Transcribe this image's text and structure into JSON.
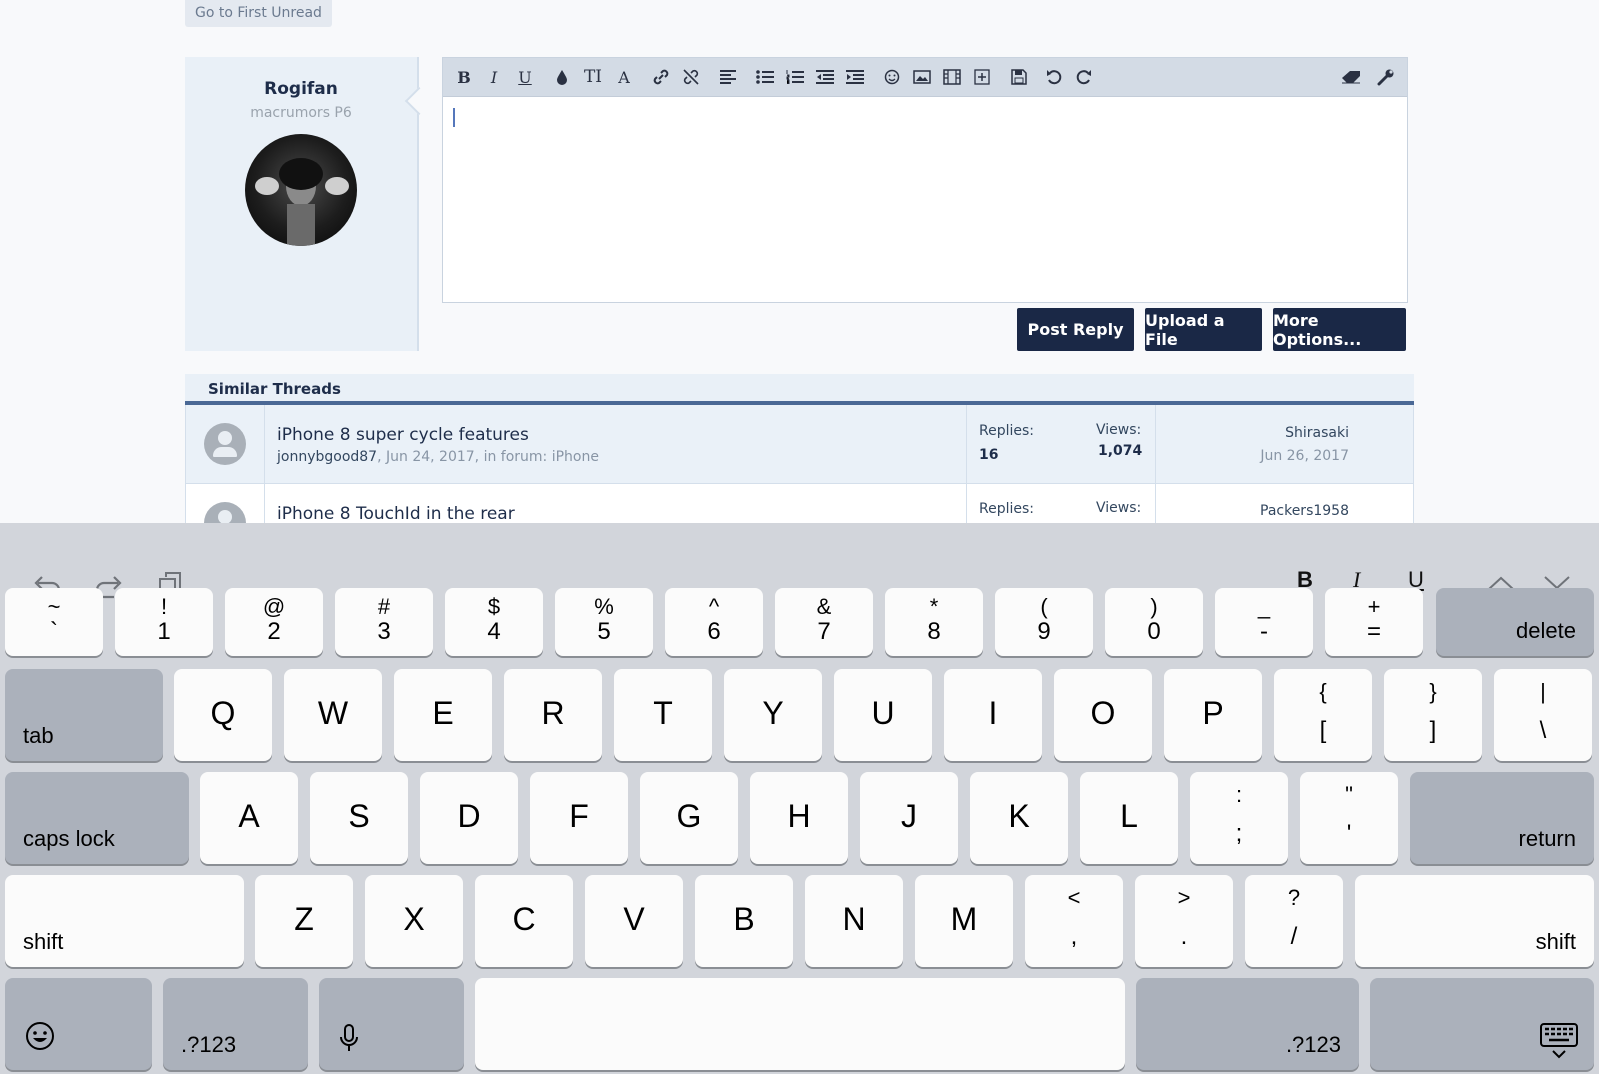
{
  "forum": {
    "first_unread": "Go to First Unread",
    "user": {
      "name": "Rogifan",
      "title": "macrumors P6"
    },
    "toolbar": {
      "icons": [
        "bold-icon",
        "italic-icon",
        "underline-icon",
        "text-color-icon",
        "font-size-icon",
        "font-family-icon",
        "link-icon",
        "unlink-icon",
        "align-icon",
        "bullet-list-icon",
        "numbered-list-icon",
        "outdent-icon",
        "indent-icon",
        "smilies-icon",
        "image-icon",
        "media-icon",
        "insert-icon",
        "save-draft-icon",
        "undo-icon",
        "redo-icon",
        "remove-format-icon",
        "settings-icon"
      ]
    },
    "buttons": {
      "post_reply": "Post Reply",
      "upload": "Upload a File",
      "more": "More Options..."
    },
    "similar": {
      "heading": "Similar Threads",
      "threads": [
        {
          "title": "iPhone 8 super cycle features",
          "starter": "jonnybgood87",
          "meta": ", Jun 24, 2017, in forum: iPhone",
          "replies_label": "Replies:",
          "replies": "16",
          "views_label": "Views:",
          "views": "1,074",
          "last_user": "Shirasaki",
          "last_date": "Jun 26, 2017"
        },
        {
          "title": "iPhone 8 TouchId in the rear",
          "replies_label": "Replies:",
          "views_label": "Views:",
          "last_user": "Packers1958"
        }
      ]
    }
  },
  "keyboard": {
    "suggestion_bar": {
      "bold": "B",
      "italic": "I",
      "underline": "U"
    },
    "number_row": [
      {
        "top": "~",
        "bot": "`"
      },
      {
        "top": "!",
        "bot": "1"
      },
      {
        "top": "@",
        "bot": "2"
      },
      {
        "top": "#",
        "bot": "3"
      },
      {
        "top": "$",
        "bot": "4"
      },
      {
        "top": "%",
        "bot": "5"
      },
      {
        "top": "^",
        "bot": "6"
      },
      {
        "top": "&",
        "bot": "7"
      },
      {
        "top": "*",
        "bot": "8"
      },
      {
        "top": "(",
        "bot": "9"
      },
      {
        "top": ")",
        "bot": "0"
      },
      {
        "top": "_",
        "bot": "-"
      },
      {
        "top": "+",
        "bot": "="
      }
    ],
    "delete": "delete",
    "tab": "tab",
    "row_q": [
      "Q",
      "W",
      "E",
      "R",
      "T",
      "Y",
      "U",
      "I",
      "O",
      "P"
    ],
    "row_q_sym": [
      {
        "top": "{",
        "bot": "["
      },
      {
        "top": "}",
        "bot": "]"
      },
      {
        "top": "|",
        "bot": "\\"
      }
    ],
    "caps_lock": "caps lock",
    "row_a": [
      "A",
      "S",
      "D",
      "F",
      "G",
      "H",
      "J",
      "K",
      "L"
    ],
    "row_a_sym": [
      {
        "top": ":",
        "bot": ";"
      },
      {
        "top": "\"",
        "bot": "'"
      }
    ],
    "return": "return",
    "shift": "shift",
    "row_z": [
      "Z",
      "X",
      "C",
      "V",
      "B",
      "N",
      "M"
    ],
    "row_z_sym": [
      {
        "top": "<",
        "bot": ","
      },
      {
        "top": ">",
        "bot": "."
      },
      {
        "top": "?",
        "bot": "/"
      }
    ],
    "numbers_key": ".?123"
  }
}
